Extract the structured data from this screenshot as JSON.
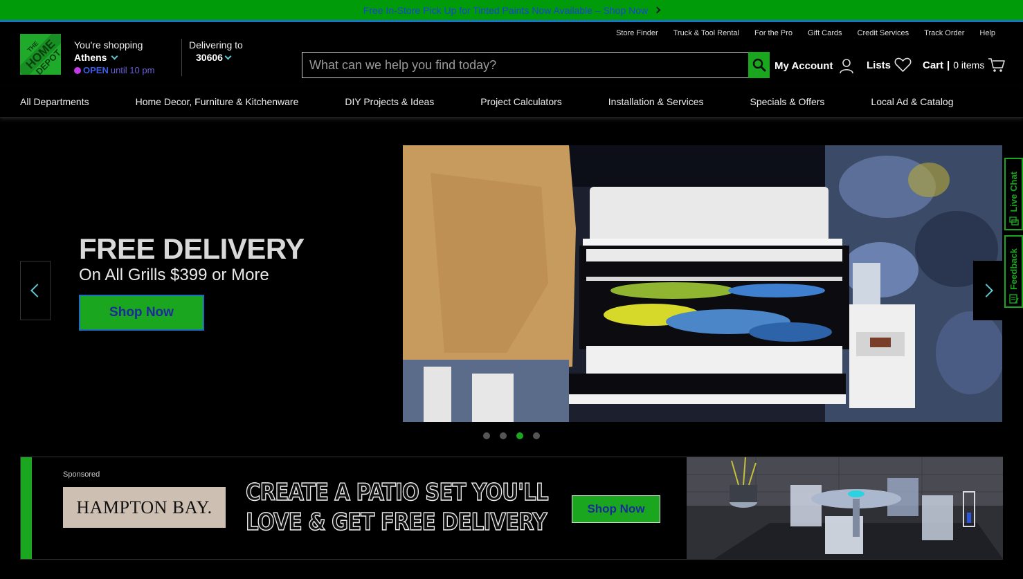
{
  "promo": {
    "text": "Free In-Store Pick Up for Tinted Paints Now Available – Shop Now"
  },
  "header": {
    "store_label": "You're shopping",
    "store_city": "Athens",
    "store_open": "OPEN",
    "store_hours": "until 10 pm",
    "deliver_label": "Delivering to",
    "deliver_zip": "30606",
    "utility_links": [
      "Store Finder",
      "Truck & Tool Rental",
      "For the Pro",
      "Gift Cards",
      "Credit Services",
      "Track Order",
      "Help"
    ],
    "search_placeholder": "What can we help you find today?",
    "account_label": "My Account",
    "lists_label": "Lists",
    "cart_label": "Cart",
    "cart_sep": "|",
    "cart_count": "0 items"
  },
  "nav": {
    "items": [
      "All Departments",
      "Home Decor, Furniture & Kitchenware",
      "DIY Projects & Ideas",
      "Project Calculators",
      "Installation & Services",
      "Specials & Offers",
      "Local Ad & Catalog"
    ]
  },
  "hero": {
    "title": "FREE DELIVERY",
    "subtitle": "On All Grills $399 or More",
    "cta": "Shop Now",
    "active_slide": 3,
    "slide_count": 4
  },
  "side_tabs": {
    "chat": "Live Chat",
    "feedback": "Feedback"
  },
  "banner": {
    "sponsored": "Sponsored",
    "brand": "HAMPTON BAY.",
    "line1": "CREATE A PATIO SET YOU'LL",
    "line2": "LOVE & GET FREE DELIVERY",
    "cta": "Shop Now"
  },
  "colors": {
    "accent": "#1aa61e",
    "promo_bg": "#009b09",
    "link_blue": "#1c41d8"
  }
}
